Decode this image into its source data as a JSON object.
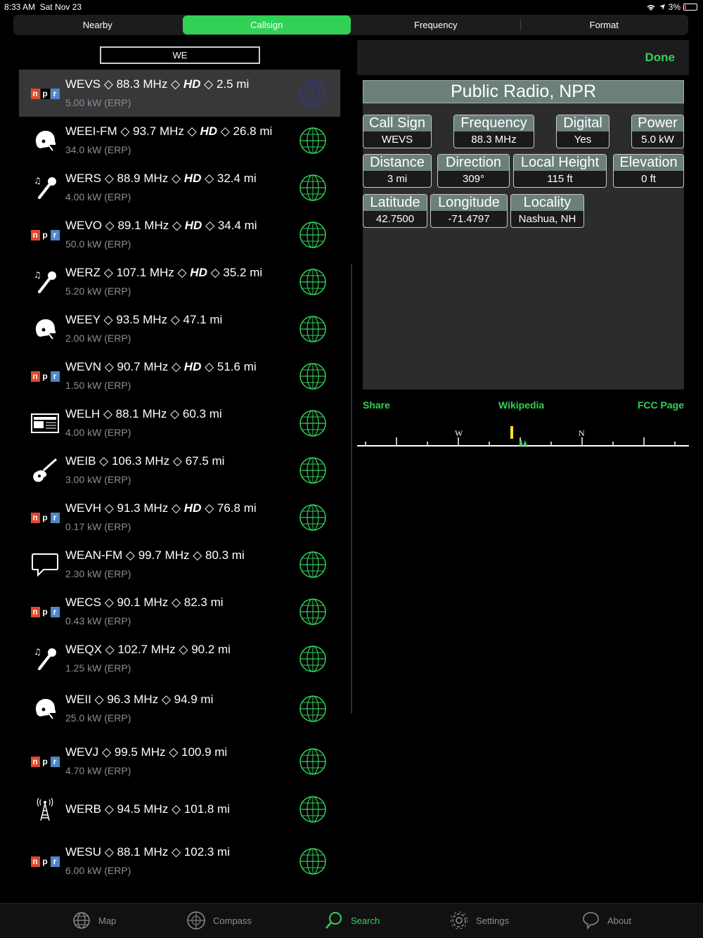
{
  "status": {
    "time": "8:33 AM",
    "date": "Sat Nov 23",
    "battery": "3%"
  },
  "segments": [
    {
      "label": "Nearby",
      "active": false
    },
    {
      "label": "Callsign",
      "active": true
    },
    {
      "label": "Frequency",
      "active": false
    },
    {
      "label": "Format",
      "active": false
    }
  ],
  "search": {
    "value": "WE"
  },
  "stations": [
    {
      "icon": "npr-logo",
      "title": "WEVS ◇ 88.3 MHz ◇ HD ◇ 2.5 mi",
      "sub": "5.00 kW (ERP)",
      "selected": true
    },
    {
      "icon": "football-helmet-icon",
      "title": "WEEI-FM ◇ 93.7 MHz ◇ HD ◇ 26.8 mi",
      "sub": "34.0 kW (ERP)"
    },
    {
      "icon": "microphone-icon",
      "title": "WERS ◇ 88.9 MHz ◇ HD ◇ 32.4 mi",
      "sub": "4.00 kW (ERP)"
    },
    {
      "icon": "npr-logo",
      "title": "WEVO ◇ 89.1 MHz ◇ HD ◇ 34.4 mi",
      "sub": "50.0 kW (ERP)"
    },
    {
      "icon": "microphone-icon",
      "title": "WERZ ◇ 107.1 MHz ◇ HD ◇ 35.2 mi",
      "sub": "5.20 kW (ERP)"
    },
    {
      "icon": "football-helmet-icon",
      "title": "WEEY ◇ 93.5 MHz ◇ 47.1 mi",
      "sub": "2.00 kW (ERP)"
    },
    {
      "icon": "npr-logo",
      "title": "WEVN ◇ 90.7 MHz ◇ HD ◇ 51.6 mi",
      "sub": "1.50 kW (ERP)"
    },
    {
      "icon": "news-icon",
      "title": "WELH ◇ 88.1 MHz ◇ 60.3 mi",
      "sub": "4.00 kW (ERP)"
    },
    {
      "icon": "guitar-icon",
      "title": "WEIB ◇ 106.3 MHz ◇ 67.5 mi",
      "sub": "3.00 kW (ERP)"
    },
    {
      "icon": "npr-logo",
      "title": "WEVH ◇ 91.3 MHz ◇ HD ◇ 76.8 mi",
      "sub": "0.17 kW (ERP)"
    },
    {
      "icon": "speech-bubble-icon",
      "title": "WEAN-FM ◇ 99.7 MHz ◇ 80.3 mi",
      "sub": "2.30 kW (ERP)"
    },
    {
      "icon": "npr-logo",
      "title": "WECS ◇ 90.1 MHz ◇ 82.3 mi",
      "sub": "0.43 kW (ERP)"
    },
    {
      "icon": "microphone-icon",
      "title": "WEQX ◇ 102.7 MHz ◇ 90.2 mi",
      "sub": "1.25 kW (ERP)"
    },
    {
      "icon": "football-helmet-icon",
      "title": "WEII ◇ 96.3 MHz ◇ 94.9 mi",
      "sub": "25.0 kW (ERP)"
    },
    {
      "icon": "npr-logo",
      "title": "WEVJ ◇ 99.5 MHz ◇ 100.9 mi",
      "sub": "4.70 kW (ERP)"
    },
    {
      "icon": "radio-tower-icon",
      "title": "WERB ◇ 94.5 MHz ◇ 101.8 mi",
      "sub": ""
    },
    {
      "icon": "npr-logo",
      "title": "WESU ◇ 88.1 MHz ◇ 102.3 mi",
      "sub": "6.00 kW (ERP)"
    }
  ],
  "npr": {
    "n": "n",
    "p": "p",
    "r": "r"
  },
  "detail": {
    "done_label": "Done",
    "title": "Public Radio, NPR",
    "fields": {
      "call_sign": {
        "label": "Call Sign",
        "value": "WEVS"
      },
      "frequency": {
        "label": "Frequency",
        "value": "88.3 MHz"
      },
      "digital": {
        "label": "Digital",
        "value": "Yes"
      },
      "power": {
        "label": "Power",
        "value": "5.0 kW"
      },
      "distance": {
        "label": "Distance",
        "value": "3 mi"
      },
      "direction": {
        "label": "Direction",
        "value": "309°"
      },
      "local_height": {
        "label": "Local Height",
        "value": "115 ft"
      },
      "elevation": {
        "label": "Elevation",
        "value": "0 ft"
      },
      "latitude": {
        "label": "Latitude",
        "value": "42.7500"
      },
      "longitude": {
        "label": "Longitude",
        "value": "-71.4797"
      },
      "locality": {
        "label": "Locality",
        "value": "Nashua, NH"
      }
    },
    "links": {
      "share": "Share",
      "wikipedia": "Wikipedia",
      "fcc": "FCC Page"
    },
    "compass": {
      "west": "W",
      "north": "N"
    }
  },
  "tabs": [
    {
      "label": "Map",
      "icon": "globe-icon",
      "active": false
    },
    {
      "label": "Compass",
      "icon": "compass-icon",
      "active": false
    },
    {
      "label": "Search",
      "icon": "search-icon",
      "active": true
    },
    {
      "label": "Settings",
      "icon": "gear-icon",
      "active": false
    },
    {
      "label": "About",
      "icon": "chat-icon",
      "active": false
    }
  ],
  "colors": {
    "accent": "#31d158",
    "header_label_bg": "#6b7f7b",
    "globe": "#31d158"
  }
}
